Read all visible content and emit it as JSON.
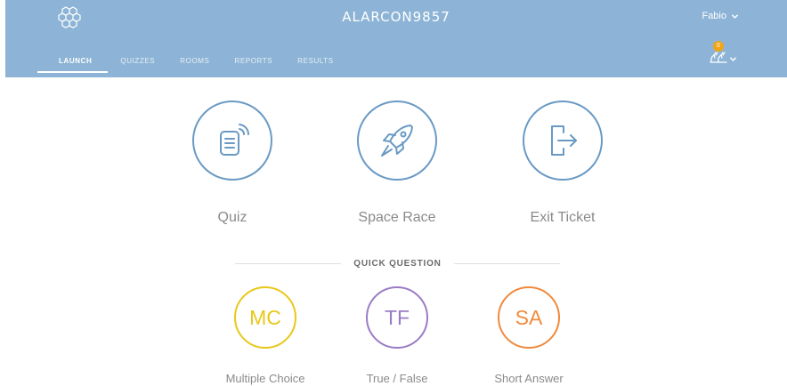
{
  "header": {
    "room_name": "ALARCON9857",
    "user_name": "Fabio",
    "notification_count": "0",
    "logo_icon": "hexagon-cluster-logo",
    "background_color": "#8db4d6"
  },
  "tabs": [
    {
      "label": "LAUNCH",
      "active": true
    },
    {
      "label": "QUIZZES",
      "active": false
    },
    {
      "label": "ROOMS",
      "active": false
    },
    {
      "label": "REPORTS",
      "active": false
    },
    {
      "label": "RESULTS",
      "active": false
    }
  ],
  "activities": [
    {
      "label": "Quiz",
      "icon": "quiz-broadcast-icon"
    },
    {
      "label": "Space Race",
      "icon": "rocket-icon"
    },
    {
      "label": "Exit Ticket",
      "icon": "exit-door-icon"
    }
  ],
  "quick_question": {
    "heading": "QUICK QUESTION",
    "items": [
      {
        "abbr": "MC",
        "label": "Multiple Choice",
        "color": "#e8c81a"
      },
      {
        "abbr": "TF",
        "label": "True / False",
        "color": "#9a7cc6"
      },
      {
        "abbr": "SA",
        "label": "Short Answer",
        "color": "#f08a3c"
      }
    ]
  },
  "accent_color": "#6a9ac4"
}
